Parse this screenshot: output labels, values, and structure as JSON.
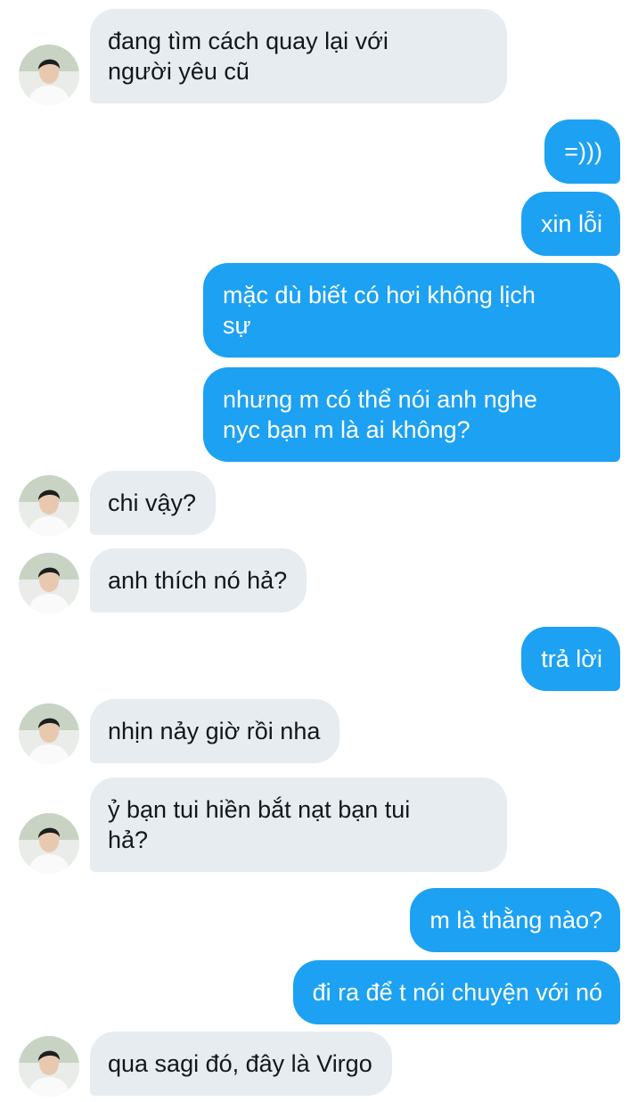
{
  "colors": {
    "incoming_bubble": "#e6ecf0",
    "outgoing_bubble": "#1da1f2",
    "incoming_text": "#14171a",
    "outgoing_text": "#ffffff"
  },
  "messages": [
    {
      "direction": "in",
      "text": "đang tìm cách quay lại với\nngười yêu cũ"
    },
    {
      "direction": "out",
      "text": "=)))"
    },
    {
      "direction": "out",
      "text": "xin lỗi"
    },
    {
      "direction": "out",
      "text": "mặc dù biết có hơi không lịch\nsự"
    },
    {
      "direction": "out",
      "text": "nhưng m có thể nói anh nghe\nnyc bạn m là ai không?"
    },
    {
      "direction": "in",
      "text": "chi vậy?"
    },
    {
      "direction": "in",
      "text": "anh thích nó hả?"
    },
    {
      "direction": "out",
      "text": "trả lời"
    },
    {
      "direction": "in",
      "text": "nhịn nảy giờ rồi nha"
    },
    {
      "direction": "in",
      "text": "ỷ bạn tui hiền bắt nạt bạn tui\nhả?"
    },
    {
      "direction": "out",
      "text": "m là thằng nào?"
    },
    {
      "direction": "out",
      "text": "đi ra để t nói chuyện với nó"
    },
    {
      "direction": "in",
      "text": "qua sagi đó, đây là Virgo"
    }
  ],
  "avatar_icon": "contact-avatar-photo"
}
